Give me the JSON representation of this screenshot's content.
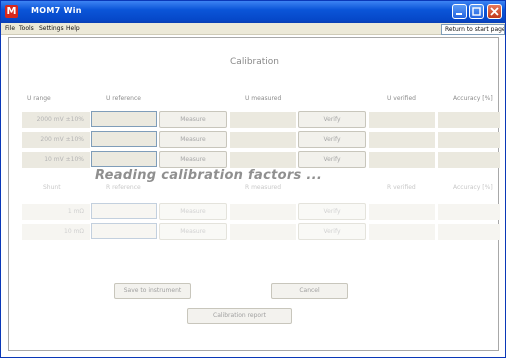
{
  "window": {
    "title": "MOM7 Win",
    "app_icon_letter": "M"
  },
  "menu": {
    "items": [
      "File",
      "Tools",
      "Settings",
      "Help"
    ],
    "return_button": "Return to start page"
  },
  "page": {
    "title": "Calibration",
    "status_overlay": "Reading calibration factors ...",
    "voltage_headers": {
      "range": "U range",
      "reference": "U reference",
      "measured": "U measured",
      "verified": "U verified",
      "accuracy": "Accuracy [%]"
    },
    "shunt_headers": {
      "range": "Shunt",
      "reference": "R reference",
      "measured": "R measured",
      "verified": "R verified",
      "accuracy": "Accuracy [%]"
    },
    "voltage_rows": [
      {
        "range": "2000 mV ±10%",
        "measure": "Measure",
        "verify": "Verify"
      },
      {
        "range": "200 mV ±10%",
        "measure": "Measure",
        "verify": "Verify"
      },
      {
        "range": "10 mV ±10%",
        "measure": "Measure",
        "verify": "Verify"
      }
    ],
    "shunt_rows": [
      {
        "range": "1 mΩ",
        "measure": "Measure",
        "verify": "Verify"
      },
      {
        "range": "10 mΩ",
        "measure": "Measure",
        "verify": "Verify"
      }
    ],
    "buttons": {
      "save": "Save to instrument",
      "cancel": "Cancel",
      "report": "Calibration report"
    }
  }
}
